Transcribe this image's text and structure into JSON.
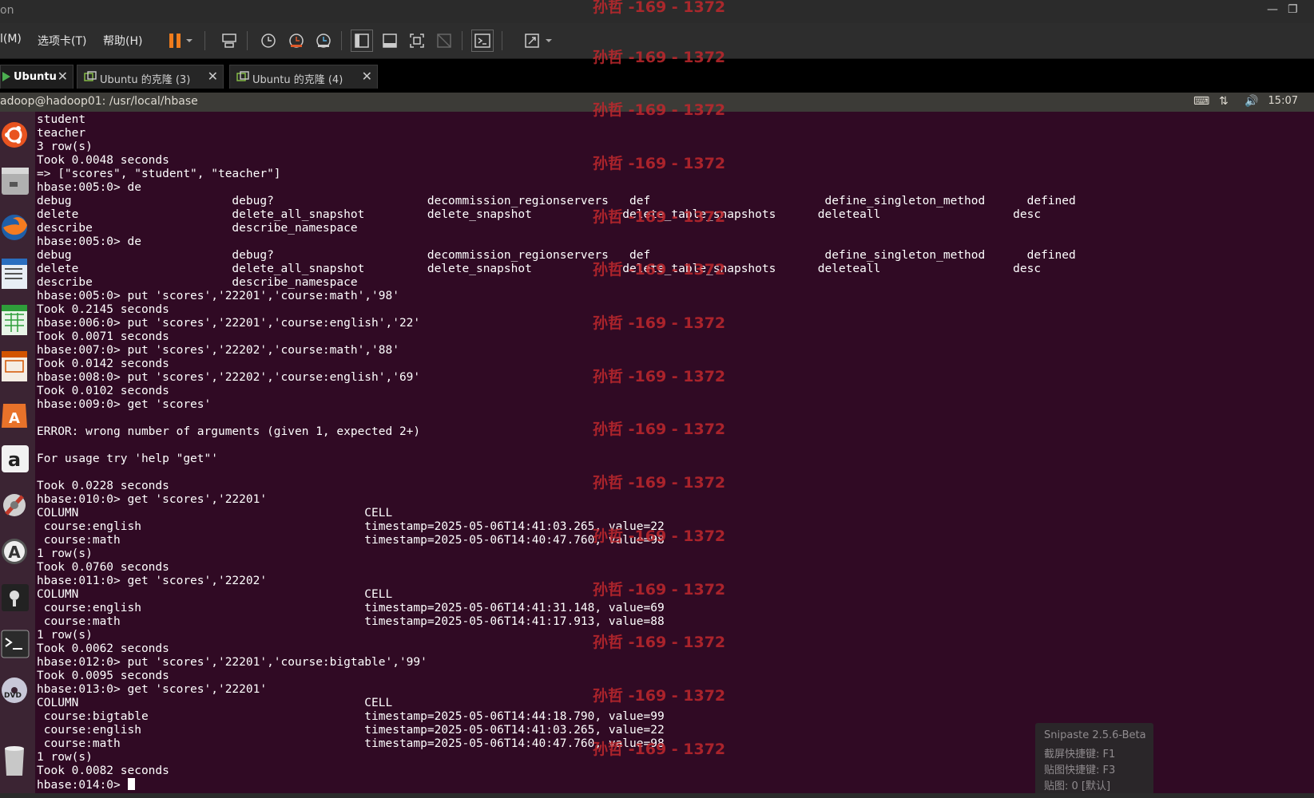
{
  "window": {
    "title_fragment": "on",
    "minimize": "—",
    "restore": "❐"
  },
  "menu": [
    "l(M)",
    "选项卡(T)",
    "帮助(H)"
  ],
  "tabs": [
    {
      "label": "Ubuntu",
      "active": true
    },
    {
      "label": "Ubuntu 的克隆 (3)",
      "active": false
    },
    {
      "label": "Ubuntu 的克隆 (4)",
      "active": false
    }
  ],
  "topbar": {
    "title": "adoop@hadoop01: /usr/local/hbase",
    "clock": "15:07"
  },
  "terminal": {
    "lines": [
      "student",
      "teacher",
      "3 row(s)",
      "Took 0.0048 seconds",
      "=> [\"scores\", \"student\", \"teacher\"]",
      "hbase:005:0> de",
      "debug                       debug?                      decommission_regionservers   def                         define_singleton_method      defined",
      "delete                      delete_all_snapshot         delete_snapshot             delete_table_snapshots      deleteall                   desc",
      "describe                    describe_namespace",
      "hbase:005:0> de",
      "debug                       debug?                      decommission_regionservers   def                         define_singleton_method      defined",
      "delete                      delete_all_snapshot         delete_snapshot             delete_table_snapshots      deleteall                   desc",
      "describe                    describe_namespace",
      "hbase:005:0> put 'scores','22201','course:math','98'",
      "Took 0.2145 seconds",
      "hbase:006:0> put 'scores','22201','course:english','22'",
      "Took 0.0071 seconds",
      "hbase:007:0> put 'scores','22202','course:math','88'",
      "Took 0.0142 seconds",
      "hbase:008:0> put 'scores','22202','course:english','69'",
      "Took 0.0102 seconds",
      "hbase:009:0> get 'scores'",
      "",
      "ERROR: wrong number of arguments (given 1, expected 2+)",
      "",
      "For usage try 'help \"get\"'",
      "",
      "Took 0.0228 seconds",
      "hbase:010:0> get 'scores','22201'",
      "COLUMN                                         CELL",
      " course:english                                timestamp=2025-05-06T14:41:03.265, value=22",
      " course:math                                   timestamp=2025-05-06T14:40:47.760, value=98",
      "1 row(s)",
      "Took 0.0760 seconds",
      "hbase:011:0> get 'scores','22202'",
      "COLUMN                                         CELL",
      " course:english                                timestamp=2025-05-06T14:41:31.148, value=69",
      " course:math                                   timestamp=2025-05-06T14:41:17.913, value=88",
      "1 row(s)",
      "Took 0.0062 seconds",
      "hbase:012:0> put 'scores','22201','course:bigtable','99'",
      "Took 0.0095 seconds",
      "hbase:013:0> get 'scores','22201'",
      "COLUMN                                         CELL",
      " course:bigtable                               timestamp=2025-05-06T14:44:18.790, value=99",
      " course:english                                timestamp=2025-05-06T14:41:03.265, value=22",
      " course:math                                   timestamp=2025-05-06T14:40:47.760, value=98",
      "1 row(s)",
      "Took 0.0082 seconds"
    ],
    "prompt": "hbase:014:0> "
  },
  "watermark": "孙哲 -169 - 1372",
  "snipaste": {
    "title": "Snipaste 2.5.6-Beta",
    "line1": "截屏快捷键: F1",
    "line2": "贴图快捷键: F3",
    "line3": "贴图: 0 [默认]"
  },
  "colors": {
    "terminal_bg": "#300a24",
    "launcher_bg": "#3b2433",
    "watermark": "#c0282d",
    "pause_orange": "#f07c1c"
  }
}
